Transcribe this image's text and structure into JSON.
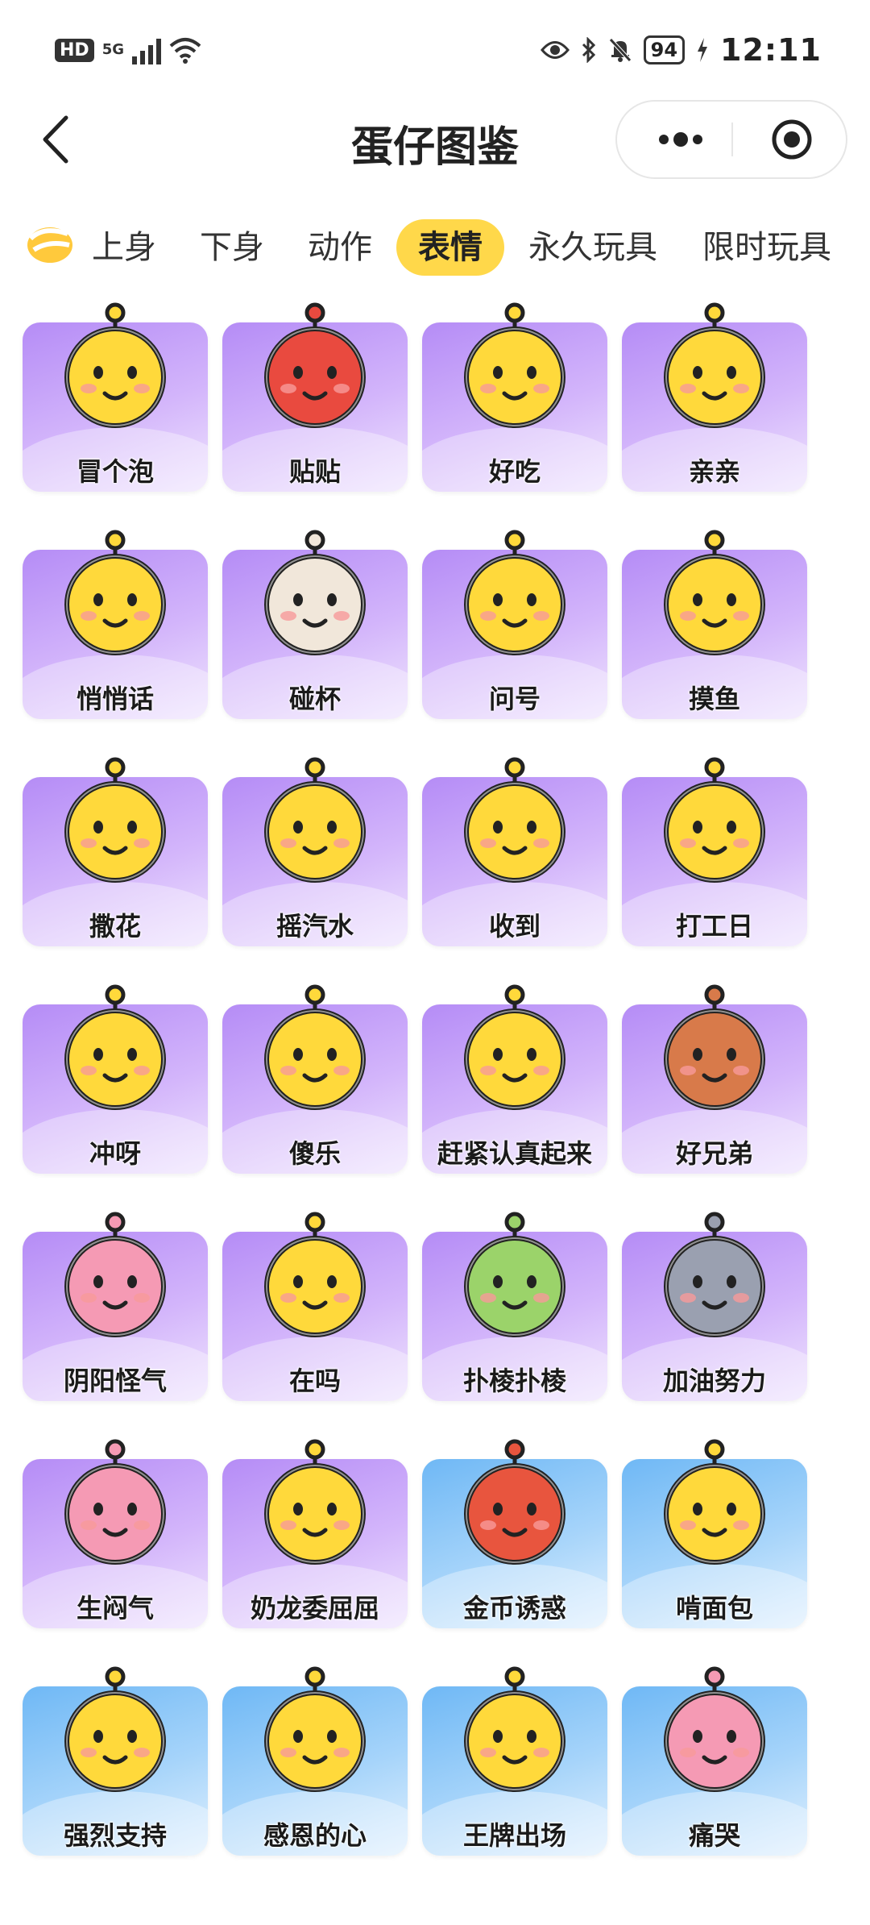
{
  "status_bar": {
    "hd": "HD",
    "network": "5G",
    "battery": "94",
    "time": "12:11"
  },
  "header": {
    "title": "蛋仔图鉴"
  },
  "tabs": [
    {
      "label": "上身",
      "active": false
    },
    {
      "label": "下身",
      "active": false
    },
    {
      "label": "动作",
      "active": false
    },
    {
      "label": "表情",
      "active": true
    },
    {
      "label": "永久玩具",
      "active": false
    },
    {
      "label": "限时玩具",
      "active": false
    }
  ],
  "items": [
    {
      "label": "冒个泡",
      "bg": "purple",
      "sticker": "egg-bubble"
    },
    {
      "label": "贴贴",
      "bg": "purple",
      "sticker": "red-black-pair"
    },
    {
      "label": "好吃",
      "bg": "purple",
      "sticker": "egg-yummy"
    },
    {
      "label": "亲亲",
      "bg": "purple",
      "sticker": "egg-kiss"
    },
    {
      "label": "悄悄话",
      "bg": "purple",
      "sticker": "egg-whisper"
    },
    {
      "label": "碰杯",
      "bg": "purple",
      "sticker": "dog-cat-cheers"
    },
    {
      "label": "问号",
      "bg": "purple",
      "sticker": "egg-question"
    },
    {
      "label": "摸鱼",
      "bg": "purple",
      "sticker": "egg-fish"
    },
    {
      "label": "撒花",
      "bg": "purple",
      "sticker": "egg-flowers"
    },
    {
      "label": "摇汽水",
      "bg": "purple",
      "sticker": "egg-soda"
    },
    {
      "label": "收到",
      "bg": "purple",
      "sticker": "egg-salute"
    },
    {
      "label": "打工日",
      "bg": "purple",
      "sticker": "egg-laptop"
    },
    {
      "label": "冲呀",
      "bg": "purple",
      "sticker": "egg-fire"
    },
    {
      "label": "傻乐",
      "bg": "purple",
      "sticker": "egg-happy"
    },
    {
      "label": "赶紧认真起来",
      "bg": "purple",
      "sticker": "egg-serious"
    },
    {
      "label": "好兄弟",
      "bg": "purple",
      "sticker": "bear-brothers"
    },
    {
      "label": "阴阳怪气",
      "bg": "purple",
      "sticker": "pink-sarcastic"
    },
    {
      "label": "在吗",
      "bg": "purple",
      "sticker": "egg-peek"
    },
    {
      "label": "扑棱扑棱",
      "bg": "purple",
      "sticker": "green-bird"
    },
    {
      "label": "加油努力",
      "bg": "purple",
      "sticker": "bunny-officer"
    },
    {
      "label": "生闷气",
      "bg": "purple",
      "sticker": "pink-hair-sulk"
    },
    {
      "label": "奶龙委屈屈",
      "bg": "purple",
      "sticker": "nailong-sad"
    },
    {
      "label": "金币诱惑",
      "bg": "blue",
      "sticker": "crab-coin"
    },
    {
      "label": "啃面包",
      "bg": "blue",
      "sticker": "egg-bread"
    },
    {
      "label": "强烈支持",
      "bg": "blue",
      "sticker": "egg-support"
    },
    {
      "label": "感恩的心",
      "bg": "blue",
      "sticker": "egg-heart-sign"
    },
    {
      "label": "王牌出场",
      "bg": "blue",
      "sticker": "egg-ace-card"
    },
    {
      "label": "痛哭",
      "bg": "blue",
      "sticker": "pink-crying"
    }
  ]
}
